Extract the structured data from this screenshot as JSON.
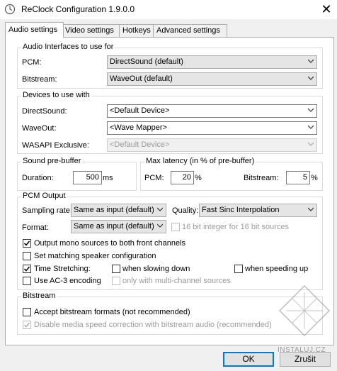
{
  "window": {
    "title": "ReClock Configuration 1.9.0.0",
    "close": "✕"
  },
  "tabs": [
    {
      "label": "Audio settings"
    },
    {
      "label": "Video settings"
    },
    {
      "label": "Hotkeys"
    },
    {
      "label": "Advanced settings"
    }
  ],
  "audio_interfaces": {
    "legend": "Audio Interfaces to use for",
    "pcm_label": "PCM:",
    "pcm_value": "DirectSound (default)",
    "bitstream_label": "Bitstream:",
    "bitstream_value": "WaveOut (default)"
  },
  "devices": {
    "legend": "Devices to use with",
    "directsound_label": "DirectSound:",
    "directsound_value": "<Default Device>",
    "waveout_label": "WaveOut:",
    "waveout_value": "<Wave Mapper>",
    "wasapi_label": "WASAPI Exclusive:",
    "wasapi_value": "<Default Device>"
  },
  "prebuffer": {
    "legend": "Sound pre-buffer",
    "duration_label": "Duration:",
    "duration_value": "500",
    "duration_unit": "ms"
  },
  "latency": {
    "legend": "Max latency (in % of pre-buffer)",
    "pcm_label": "PCM:",
    "pcm_value": "20",
    "pcm_unit": "%",
    "bitstream_label": "Bitstream:",
    "bitstream_value": "5",
    "bitstream_unit": "%"
  },
  "pcm_output": {
    "legend": "PCM Output",
    "sampling_label": "Sampling rate:",
    "sampling_value": "Same as input (default)",
    "quality_label": "Quality:",
    "quality_value": "Fast Sinc Interpolation",
    "format_label": "Format:",
    "format_value": "Same as input (default)",
    "bit16_label": "16 bit integer for 16 bit sources",
    "mono_label": "Output mono sources to both front channels",
    "speaker_label": "Set matching speaker configuration",
    "stretch_label": "Time Stretching:",
    "slowing_label": "when slowing down",
    "speeding_label": "when speeding up",
    "ac3_label": "Use AC-3 encoding",
    "multichannel_label": "only with multi-channel sources"
  },
  "bitstream": {
    "legend": "Bitstream",
    "accept_label": "Accept bitstream formats (not recommended)",
    "disable_label": "Disable media speed correction with bitstream audio (recommended)"
  },
  "buttons": {
    "ok": "OK",
    "cancel": "Zrušit"
  },
  "watermark": {
    "text": "INSTALUJ.CZ"
  },
  "colors": {
    "accent": "#0078d7",
    "disabled_text": "#9a9a9a"
  }
}
